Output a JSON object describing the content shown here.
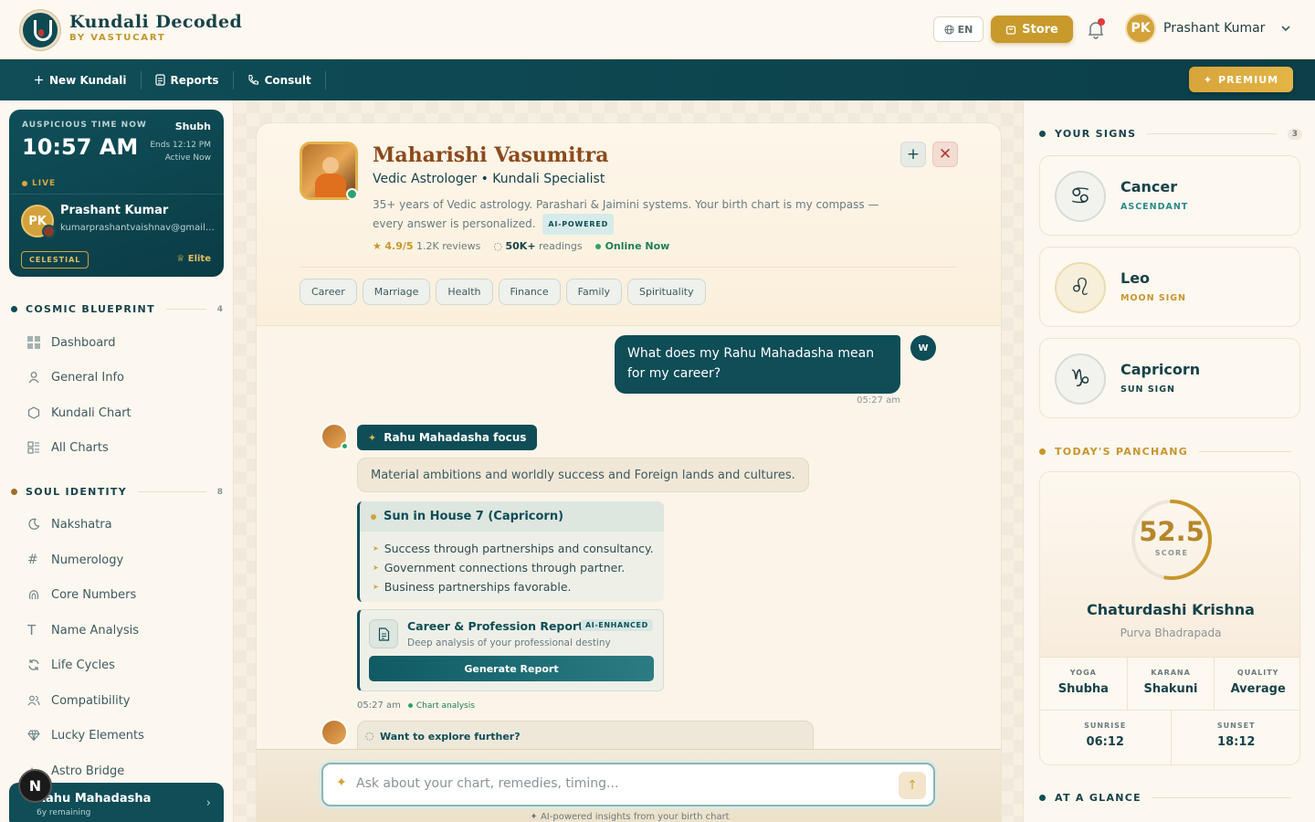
{
  "header": {
    "brand_title": "Kundali Decoded",
    "brand_sub": "BY VASTUCART",
    "lang": "EN",
    "store": "Store",
    "user_initials": "PK",
    "user_name": "Prashant Kumar"
  },
  "nav": {
    "items": [
      {
        "label": "New Kundali",
        "icon": "plus-icon"
      },
      {
        "label": "Reports",
        "icon": "document-icon"
      },
      {
        "label": "Consult",
        "icon": "phone-icon"
      }
    ],
    "premium": "PREMIUM"
  },
  "timecard": {
    "label": "AUSPICIOUS TIME NOW",
    "quality": "Shubh",
    "time": "10:57 AM",
    "ends": "Ends 12:12 PM",
    "active": "Active Now",
    "live": "LIVE",
    "initials": "PK",
    "name": "Prashant Kumar",
    "email": "kumarprashantvaishnav@gmail.com",
    "badge": "CELESTIAL",
    "tier": "Elite"
  },
  "sidebar": {
    "sections": [
      {
        "title": "COSMIC BLUEPRINT",
        "count": "4"
      },
      {
        "title": "SOUL IDENTITY",
        "count": "8"
      }
    ],
    "cosmic": [
      "Dashboard",
      "General Info",
      "Kundali Chart",
      "All Charts"
    ],
    "soul": [
      "Nakshatra",
      "Numerology",
      "Core Numbers",
      "Name Analysis",
      "Life Cycles",
      "Compatibility",
      "Lucky Elements",
      "Astro Bridge"
    ],
    "dasha_title": "Rahu Mahadasha",
    "dasha_sub": "6y remaining",
    "n_badge": "N"
  },
  "astrologer": {
    "name": "Maharishi Vasumitra",
    "role": "Vedic Astrologer • Kundali Specialist",
    "desc": "35+ years of Vedic astrology. Parashari & Jaimini systems. Your birth chart is my compass — every answer is personalized.",
    "ai_badge": "AI-POWERED",
    "rating": "4.9/5",
    "reviews": "1.2K reviews",
    "readings_count": "50K+",
    "readings_label": "readings",
    "status": "Online Now",
    "tags": [
      "Career",
      "Marriage",
      "Health",
      "Finance",
      "Family",
      "Spirituality"
    ]
  },
  "chat": {
    "user_msg": "What does my Rahu Mahadasha mean for my career?",
    "user_avatar": "W",
    "user_time": "05:27 am",
    "focus": "Rahu Mahadasha focus",
    "summary": "Material ambitions and worldly success and Foreign lands and cultures.",
    "house_title": "Sun in House 7 (Capricorn)",
    "house_points": [
      "Success through partnerships and consultancy.",
      "Government connections through partner.",
      "Business partnerships favorable."
    ],
    "report_title": "Career & Profession Report",
    "report_badge": "AI-ENHANCED",
    "report_sub": "Deep analysis of your professional destiny",
    "report_btn": "Generate Report",
    "bot_time": "05:27 am",
    "bot_tag": "Chart analysis",
    "explore": "Want to explore further?",
    "placeholder": "Ask about your chart, remedies, timing...",
    "footer": "✦ AI-powered insights from your birth chart"
  },
  "signs": {
    "title": "YOUR SIGNS",
    "count": "3",
    "items": [
      {
        "name": "Cancer",
        "type": "ASCENDANT",
        "glyph": "♋"
      },
      {
        "name": "Leo",
        "type": "MOON SIGN",
        "glyph": "♌"
      },
      {
        "name": "Capricorn",
        "type": "SUN SIGN",
        "glyph": "♑"
      }
    ]
  },
  "panchang": {
    "title": "TODAY'S PANCHANG",
    "score": "52.5",
    "score_fraction": 0.525,
    "score_label": "SCORE",
    "tithi": "Chaturdashi Krishna",
    "nakshatra": "Purva Bhadrapada",
    "cells": [
      {
        "k": "YOGA",
        "v": "Shubha"
      },
      {
        "k": "KARANA",
        "v": "Shakuni"
      },
      {
        "k": "QUALITY",
        "v": "Average"
      }
    ],
    "sun": [
      {
        "k": "SUNRISE",
        "v": "06:12"
      },
      {
        "k": "SUNSET",
        "v": "18:12"
      }
    ],
    "glance": "AT A GLANCE"
  }
}
